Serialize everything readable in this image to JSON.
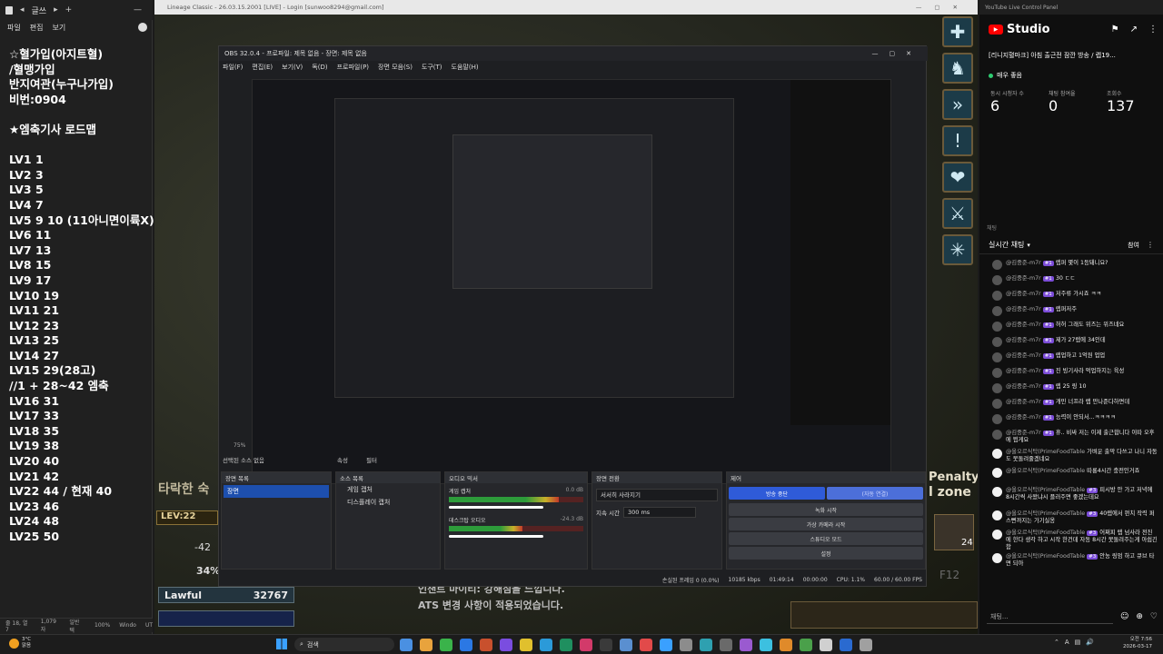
{
  "notepad": {
    "menu": [
      "파일",
      "편집",
      "보기"
    ],
    "tab_label": "글쓰",
    "lines": [
      "☆혈가입(아지트혈)",
      "/혈맹가입",
      "반지여관(누구나가입)",
      "비번:0904",
      "",
      "★엠축기사 로드맵",
      "",
      "LV1 1",
      "LV2 3",
      "LV3 5",
      "LV4 7",
      "LV5 9 10 (11아니면이륙X)",
      "LV6 11",
      "LV7 13",
      "LV8 15",
      "LV9 17",
      "LV10 19",
      "LV11 21",
      "LV12 23",
      "LV13 25",
      "LV14 27",
      "LV15 29(28고)",
      "//1 + 28~42 엠축",
      "LV16 31",
      "LV17 33",
      "LV18 35",
      "LV19 38",
      "LV20 40",
      "LV21 42",
      "LV22 44 / 현재 40",
      "LV23 46",
      "LV24 48",
      "LV25 50"
    ],
    "status": [
      "줄 18, 열 7",
      "1,079자",
      "일반 텍",
      "100%",
      "Windo",
      "UT"
    ]
  },
  "game": {
    "title": "Lineage Classic - 26.03.15.2001 [LIVE] - Login [sunwoo8294@gmail.com]",
    "level_label": "LEV:22",
    "hp_percent_label": "34%",
    "alignment_label": "Lawful",
    "alignment_value": "32767",
    "location_text": "타락한 숙",
    "penalty_text": "Penalty",
    "zone_text": "l zone",
    "system_msg_1": "인챈트 마이티: 강해짐을 느낍니다.",
    "system_msg_2": "ATS 변경 사항이 적용되었습니다.",
    "hotkey_f12": "F12",
    "item_count": "24",
    "side_mp": "-42"
  },
  "obs": {
    "title": "OBS 32.0.4 - 프로파일: 제목 없음 - 장면: 제목 없음",
    "menu": [
      "파일(F)",
      "편집(E)",
      "보기(V)",
      "독(D)",
      "프로파일(P)",
      "장면 모음(S)",
      "도구(T)",
      "도움말(H)"
    ],
    "zoom": "75%",
    "context_bar": "선택된 소스 없음",
    "props_label": "속성",
    "filter_label": "필터",
    "docks": {
      "scenes": {
        "title": "장면 목록",
        "items": [
          "장면"
        ]
      },
      "sources": {
        "title": "소스 목록",
        "items": [
          "게임 캡처",
          "디스플레이 캡처"
        ]
      },
      "mixer": {
        "title": "오디오 믹서",
        "channels": [
          {
            "name": "게임 캡처",
            "db": "0.0 dB",
            "level": 0.82
          },
          {
            "name": "데스크탑 오디오",
            "db": "-24.3 dB",
            "level": 0.55
          }
        ]
      },
      "transitions": {
        "title": "장면 전환",
        "type": "서서히 사라지기",
        "duration_label": "지속 시간",
        "duration": "300 ms"
      },
      "controls": {
        "title": "제어",
        "buttons": [
          "방송 중단",
          "(자동 연결)",
          "녹화 시작",
          "가상 카메라 시작",
          "스튜디오 모드",
          "설정"
        ]
      }
    },
    "status": {
      "dropped": "손실된 프레임 0 (0.0%)",
      "bitrate": "10185 kbps",
      "live_time": "01:49:14",
      "rec_time": "00:00:00",
      "cpu": "CPU: 1.1%",
      "fps": "60.00 / 60.00 FPS"
    }
  },
  "youtube": {
    "window_title": "YouTube Live Control Panel",
    "brand": "Studio",
    "stream_title": "[리니지혈마크] 아침 출근전 잠깐 방송 / 렙19...",
    "status": "매우 좋음",
    "stats": [
      {
        "label": "동시 시청자 수",
        "value": "6"
      },
      {
        "label": "채팅 참여율",
        "value": "0"
      },
      {
        "label": "조회수",
        "value": "137"
      }
    ],
    "chat_header": "채팅",
    "chat_mode": "실시간 채팅",
    "chat_filter": "참여",
    "chat_input_placeholder": "채팅...",
    "messages": [
      {
        "name": "@김중준-m7r",
        "badge": "#1",
        "text": "렙퍼 몇이 1등돼니요?"
      },
      {
        "name": "@김중준-m7r",
        "badge": "#1",
        "text": "30 ㄷㄷ"
      },
      {
        "name": "@김중준-m7r",
        "badge": "#1",
        "text": "저주류 가시죠 ㅋㅋ"
      },
      {
        "name": "@김중준-m7r",
        "badge": "#1",
        "text": "렙퍼저주"
      },
      {
        "name": "@김중준-m7r",
        "badge": "#1",
        "text": "허허 그래도 위즈는 위즈네요"
      },
      {
        "name": "@김중준-m7r",
        "badge": "#1",
        "text": "제가 27렙에 34인데"
      },
      {
        "name": "@김중준-m7r",
        "badge": "#1",
        "text": "렙업하고 1억원 업업"
      },
      {
        "name": "@김중준-m7r",
        "badge": "#1",
        "text": "진 빙기사라 먹업하지는 육성"
      },
      {
        "name": "@김중준-m7r",
        "badge": "#1",
        "text": "렙 25 링 10"
      },
      {
        "name": "@김중준-m7r",
        "badge": "#1",
        "text": "개민 너프라 렙 만나준다하면데"
      },
      {
        "name": "@김중준-m7r",
        "badge": "#1",
        "text": "능력이 안되서...ㅋㅋㅋㅋ"
      },
      {
        "name": "@김중준-m7r",
        "badge": "#1",
        "text": "휴.. 비싸 저는 이제 출근합니다 이따 오후에 뵙게요"
      },
      {
        "name": "@올오르식탁(PrimeFoodTable",
        "badge": "",
        "text": "가벼운 출막 다쓰고 나니 자동도 못돌려줄겠네요"
      },
      {
        "name": "@올오르식탁(PrimeFoodTable",
        "badge": "",
        "text": "따룡4시간 충전인거죠"
      },
      {
        "name": "@올오르식탁(PrimeFoodTable",
        "badge": "#3",
        "text": "피시방 안 가고 저녁에 8시간씩 사왔냐시 플러주면 좋겠는데요"
      },
      {
        "name": "@올오르식탁(PrimeFoodTable",
        "badge": "#3",
        "text": "40렙에서 펀치 작력 퍼스뻔까지는 가기실옹"
      },
      {
        "name": "@올오르식탁(PrimeFoodTable",
        "badge": "#3",
        "text": "어쩌피 렙 넘사라 전진에 한다 생각 하고 시작 한건데 자동 8시간 못돌려주는게 아쉽긴함"
      },
      {
        "name": "@올오르식탁(PrimeFoodTable",
        "badge": "#3",
        "text": "안농 링엄 하고 큐브 타면 되아"
      }
    ]
  },
  "taskbar": {
    "weather_temp": "3°C",
    "weather_desc": "맑음",
    "search_label": "검색",
    "time": "오전 7:56",
    "date": "2026-03-17"
  }
}
